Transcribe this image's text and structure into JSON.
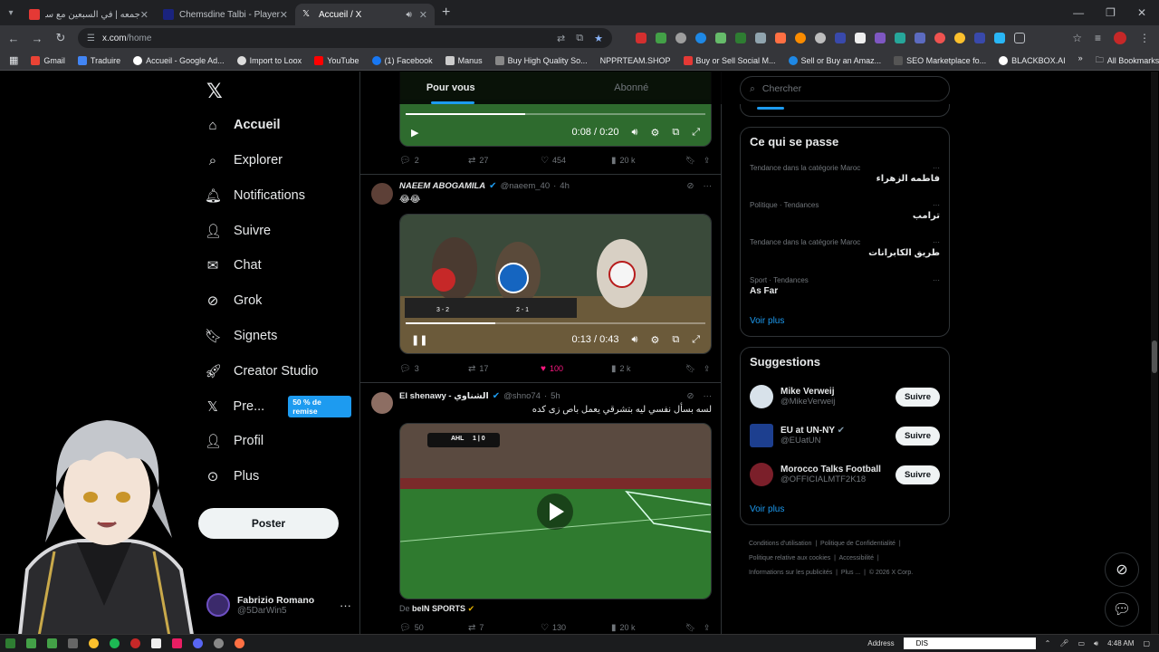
{
  "browser": {
    "tabs": [
      {
        "label": "جمعه | في السبعين مع سين جيم ...",
        "active": false
      },
      {
        "label": "Chemsdine Talbi - Player profile",
        "active": false
      },
      {
        "label": "Accueil / X",
        "active": true
      }
    ],
    "url_host": "x.com",
    "url_path": "/home",
    "bookmarks": [
      "Gmail",
      "Traduire",
      "Accueil - Google Ad...",
      "Import to Loox",
      "YouTube",
      "(1) Facebook",
      "Manus",
      "Buy High Quality So...",
      "NPPRTEAM.SHOP",
      "Buy or Sell Social M...",
      "Sell or Buy an Amaz...",
      "SEO Marketplace fo...",
      "BLACKBOX.AI"
    ],
    "all_bookmarks": "All Bookmarks"
  },
  "nav": {
    "items": [
      {
        "label": "Accueil",
        "icon": "home-icon"
      },
      {
        "label": "Explorer",
        "icon": "search-icon"
      },
      {
        "label": "Notifications",
        "icon": "bell-icon"
      },
      {
        "label": "Suivre",
        "icon": "add-user-icon"
      },
      {
        "label": "Chat",
        "icon": "mail-icon"
      },
      {
        "label": "Grok",
        "icon": "grok-icon"
      },
      {
        "label": "Signets",
        "icon": "bookmark-icon"
      },
      {
        "label": "Creator Studio",
        "icon": "rocket-icon"
      },
      {
        "label": "Pre...",
        "icon": "x-icon"
      },
      {
        "label": "Profil",
        "icon": "person-icon"
      },
      {
        "label": "Plus",
        "icon": "more-circle-icon"
      }
    ],
    "promo": "50 % de remise",
    "post_button": "Poster",
    "account_name": "Fabrizio Romano",
    "account_handle": "@5DarWin5"
  },
  "feed": {
    "tabs": [
      "Pour vous",
      "Abonné"
    ],
    "tweet0": {
      "video_time": "0:08 / 0:20",
      "progress": 0.4,
      "replies": "2",
      "reposts": "27",
      "likes": "454",
      "views": "20 k"
    },
    "tweet1": {
      "name": "NAEEM ABOGAMILA",
      "handle": "@naeem_40",
      "time": "4h",
      "text": "😂😂",
      "video_time": "0:13 / 0:43",
      "progress": 0.3,
      "replies": "3",
      "reposts": "17",
      "likes": "100",
      "views": "2 k"
    },
    "tweet2": {
      "name": "El shenawy - الشناوي",
      "handle": "@shno74",
      "time": "5h",
      "text": "لسه بسأل نفسي ليه بتشرقي يعمل باص زى كده",
      "score_home": "AHL",
      "score": "1 | 0",
      "source_prefix": "De",
      "source": "beIN SPORTS",
      "replies": "50",
      "reposts": "7",
      "likes": "130",
      "views": "20 k"
    }
  },
  "sidebar": {
    "search_placeholder": "Chercher",
    "trends_title": "Ce qui se passe",
    "trends": [
      {
        "category": "Tendance dans la catégorie Maroc",
        "name": "فاطمه الزهراء",
        "rtl": true
      },
      {
        "category": "Politique · Tendances",
        "name": "ترامب",
        "rtl": true
      },
      {
        "category": "Tendance dans la catégorie Maroc",
        "name": "طريق الكابرانات",
        "rtl": true
      },
      {
        "category": "Sport · Tendances",
        "name": "As Far",
        "rtl": false
      }
    ],
    "see_more": "Voir plus",
    "suggestions_title": "Suggestions",
    "suggestions": [
      {
        "name": "Mike Verweij",
        "handle": "@MikeVerweij",
        "follow": "Suivre"
      },
      {
        "name": "EU at UN-NY",
        "handle": "@EUatUN",
        "follow": "Suivre"
      },
      {
        "name": "Morocco Talks Football",
        "handle": "@OFFICIALMTF2K18",
        "follow": "Suivre"
      }
    ],
    "footer": [
      "Conditions d'utilisation",
      "Politique de Confidentialité",
      "Politique relative aux cookies",
      "Accessibilité",
      "Informations sur les publicités",
      "Plus ...",
      "© 2026 X Corp."
    ]
  },
  "taskbar": {
    "address_label": "Address",
    "address_value": "DIS",
    "clock": "4:48 AM"
  },
  "colors": {
    "accent": "#1d9bf0",
    "like": "#f91880",
    "bg": "#000000"
  }
}
